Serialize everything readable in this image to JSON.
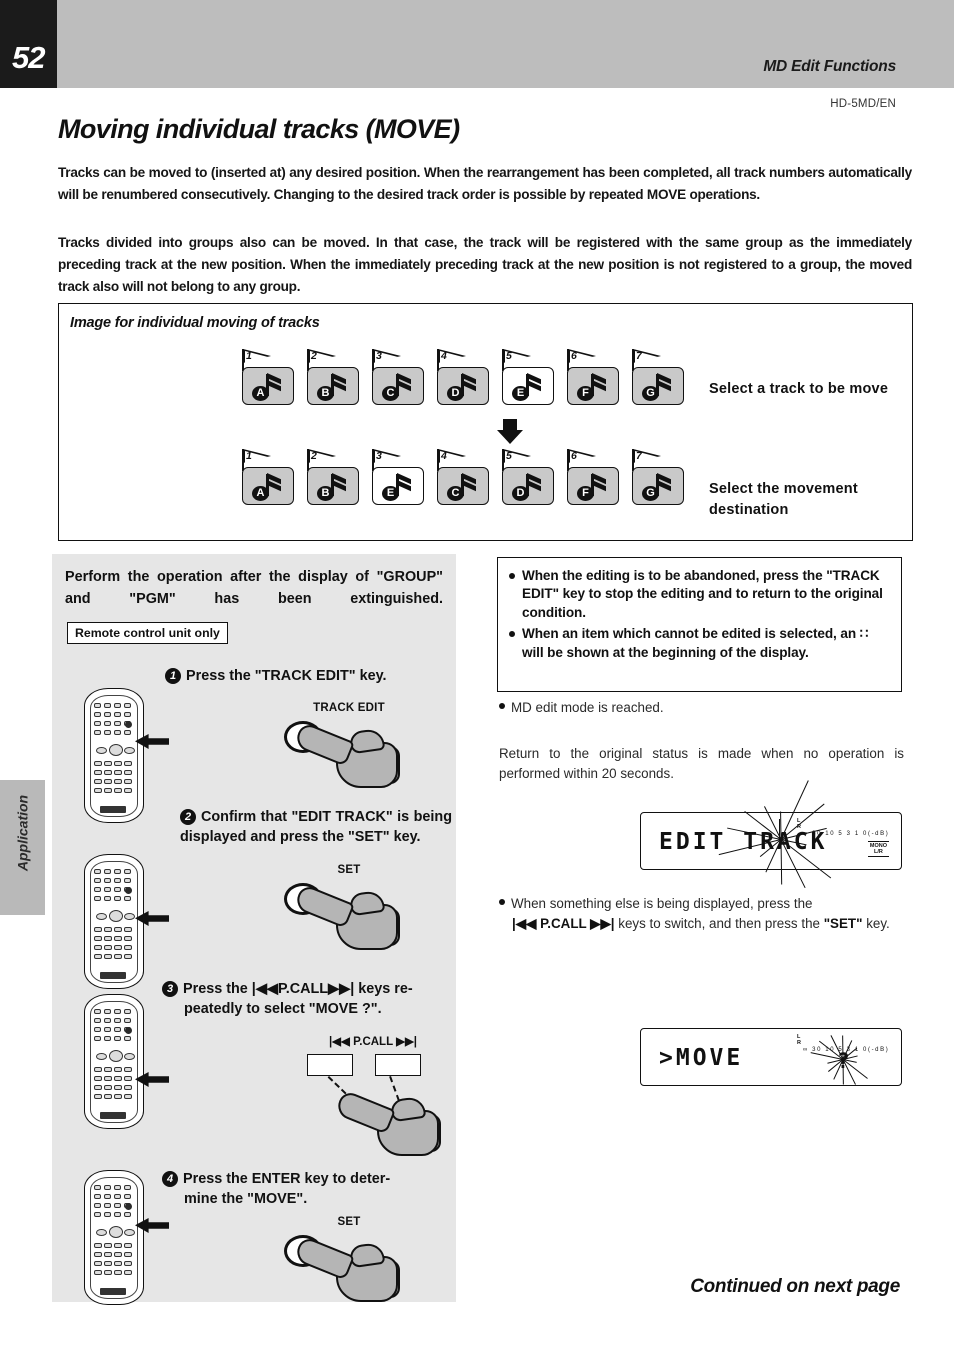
{
  "header": {
    "page_number": "52",
    "section_title": "MD Edit Functions",
    "model_code": "HD-5MD/EN"
  },
  "main_title": "Moving individual tracks (MOVE)",
  "intro": {
    "paragraph1": "Tracks can be moved to (inserted at) any desired position. When the rearrangement has been completed, all track numbers automatically will be renumbered consecutively. Changing to the desired track order is possible by repeated MOVE operations.",
    "paragraph2": "Tracks divided into groups also can be moved. In that case, the track will be registered with the same group as the immediately preceding track at the new position. When the immediately preceding track at the new position is not registered to a group, the moved track also will not belong to any group."
  },
  "diagram": {
    "title": "Image for individual moving of tracks",
    "caption_top": "Select a track to be move",
    "caption_bottom": "Select the movement destination",
    "row_top": [
      {
        "number": "1",
        "letter": "A",
        "highlight": "gray"
      },
      {
        "number": "2",
        "letter": "B",
        "highlight": "gray"
      },
      {
        "number": "3",
        "letter": "C",
        "highlight": "gray"
      },
      {
        "number": "4",
        "letter": "D",
        "highlight": "gray"
      },
      {
        "number": "5",
        "letter": "E",
        "highlight": "white"
      },
      {
        "number": "6",
        "letter": "F",
        "highlight": "gray"
      },
      {
        "number": "7",
        "letter": "G",
        "highlight": "gray"
      }
    ],
    "row_bottom": [
      {
        "number": "1",
        "letter": "A",
        "highlight": "gray"
      },
      {
        "number": "2",
        "letter": "B",
        "highlight": "gray"
      },
      {
        "number": "3",
        "letter": "E",
        "highlight": "white"
      },
      {
        "number": "4",
        "letter": "C",
        "highlight": "gray"
      },
      {
        "number": "5",
        "letter": "D",
        "highlight": "gray"
      },
      {
        "number": "6",
        "letter": "F",
        "highlight": "gray"
      },
      {
        "number": "7",
        "letter": "G",
        "highlight": "gray"
      }
    ]
  },
  "left_panel": {
    "perform_note": "Perform the operation after the display of \"GROUP\" and \"PGM\" has been extinguished.",
    "remote_only_badge": "Remote control unit only",
    "steps": [
      {
        "num": "1",
        "text": "Press the \"TRACK EDIT\" key.",
        "key_label": "TRACK EDIT"
      },
      {
        "num": "2",
        "text": "Confirm that \"EDIT TRACK\" is being displayed and press the \"SET\" key.",
        "key_label": "SET"
      },
      {
        "num": "3",
        "text_line1": "Press the |◀◀P.CALL▶▶| keys re-",
        "text_line2": "peatedly to select \"MOVE ?\".",
        "key_label": "|◀◀  P.CALL  ▶▶|"
      },
      {
        "num": "4",
        "text_line1": "Press the ENTER key to deter-",
        "text_line2": "mine the \"MOVE\".",
        "key_label": "SET"
      }
    ]
  },
  "right_column": {
    "note_box": [
      "When the editing is to be abandoned, press the \"TRACK EDIT\" key to stop the editing and to return to the original condition.",
      "When an item which cannot be edited is selected, an ∷ will be shown at the beginning of the display."
    ],
    "md_edit_mode": "MD edit mode is reached.",
    "return_note": "Return to the original status is made when no operation is performed within 20 seconds.",
    "switch_note_line1": "When something else is being displayed, press the",
    "switch_note_keys": "|◀◀  P.CALL  ▶▶|",
    "switch_note_line2": "keys to switch, and then press the",
    "switch_note_set": "\"SET\"",
    "switch_note_line3": "key."
  },
  "lcd": {
    "display1_text": "EDIT TRACK",
    "display2_text": ">MOVE",
    "display2_cursor": "?",
    "scale_channels_l": "L",
    "scale_channels_r": "R",
    "scale_ticks": "∞ 30 10 5 3 1 0(-dB)",
    "badge_top": "MONO",
    "badge_bottom": "L/R"
  },
  "side_tab_label": "Application",
  "footer": "Continued on next page"
}
